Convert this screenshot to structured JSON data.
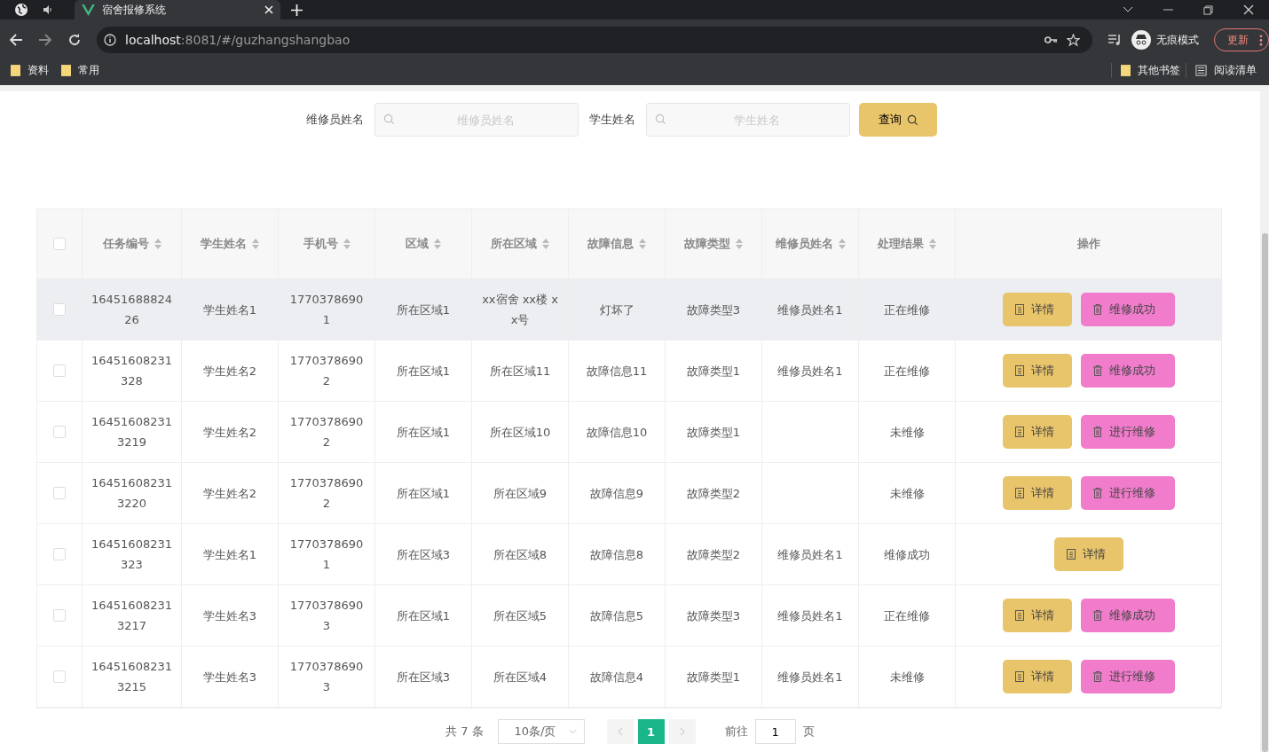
{
  "browser": {
    "tab_title": "宿舍报修系统",
    "url_host": "localhost",
    "url_rest": ":8081/#/guzhangshangbao",
    "incognito_label": "无痕模式",
    "update_button": "更新",
    "bookmarks": [
      "资料",
      "常用"
    ],
    "other_bookmarks": "其他书签",
    "reading_list": "阅读清单"
  },
  "search": {
    "fields": [
      {
        "label": "维修员姓名",
        "placeholder": "维修员姓名"
      },
      {
        "label": "学生姓名",
        "placeholder": "学生姓名"
      }
    ],
    "button": "查询"
  },
  "table": {
    "select_all_checked": false,
    "columns": [
      {
        "label": "任务编号",
        "sortable": true
      },
      {
        "label": "学生姓名",
        "sortable": true
      },
      {
        "label": "手机号",
        "sortable": true
      },
      {
        "label": "区域",
        "sortable": true
      },
      {
        "label": "所在区域",
        "sortable": true
      },
      {
        "label": "故障信息",
        "sortable": true
      },
      {
        "label": "故障类型",
        "sortable": true
      },
      {
        "label": "维修员姓名",
        "sortable": true
      },
      {
        "label": "处理结果",
        "sortable": true
      },
      {
        "label": "操作",
        "sortable": false
      }
    ],
    "rows": [
      {
        "checked": false,
        "highlighted": true,
        "cells": [
          "1645168882426",
          "学生姓名1",
          "17703786901",
          "所在区域1",
          "xx宿舍 xx楼 xx号",
          "灯坏了",
          "故障类型3",
          "维修员姓名1",
          "正在维修"
        ],
        "actions": [
          {
            "kind": "detail",
            "label": "详情"
          },
          {
            "kind": "repair",
            "label": "维修成功"
          }
        ]
      },
      {
        "checked": false,
        "highlighted": false,
        "cells": [
          "16451608231328",
          "学生姓名2",
          "17703786902",
          "所在区域1",
          "所在区域11",
          "故障信息11",
          "故障类型1",
          "维修员姓名1",
          "正在维修"
        ],
        "actions": [
          {
            "kind": "detail",
            "label": "详情"
          },
          {
            "kind": "repair",
            "label": "维修成功"
          }
        ]
      },
      {
        "checked": false,
        "highlighted": false,
        "cells": [
          "164516082313219",
          "学生姓名2",
          "17703786902",
          "所在区域1",
          "所在区域10",
          "故障信息10",
          "故障类型1",
          "",
          "未维修"
        ],
        "actions": [
          {
            "kind": "detail",
            "label": "详情"
          },
          {
            "kind": "repair",
            "label": "进行维修"
          }
        ]
      },
      {
        "checked": false,
        "highlighted": false,
        "cells": [
          "164516082313220",
          "学生姓名2",
          "17703786902",
          "所在区域1",
          "所在区域9",
          "故障信息9",
          "故障类型2",
          "",
          "未维修"
        ],
        "actions": [
          {
            "kind": "detail",
            "label": "详情"
          },
          {
            "kind": "repair",
            "label": "进行维修"
          }
        ]
      },
      {
        "checked": false,
        "highlighted": false,
        "cells": [
          "16451608231323",
          "学生姓名1",
          "17703786901",
          "所在区域3",
          "所在区域8",
          "故障信息8",
          "故障类型2",
          "维修员姓名1",
          "维修成功"
        ],
        "actions": [
          {
            "kind": "detail",
            "label": "详情"
          }
        ]
      },
      {
        "checked": false,
        "highlighted": false,
        "cells": [
          "164516082313217",
          "学生姓名3",
          "17703786903",
          "所在区域1",
          "所在区域5",
          "故障信息5",
          "故障类型3",
          "维修员姓名1",
          "正在维修"
        ],
        "actions": [
          {
            "kind": "detail",
            "label": "详情"
          },
          {
            "kind": "repair",
            "label": "维修成功"
          }
        ]
      },
      {
        "checked": false,
        "highlighted": false,
        "cells": [
          "164516082313215",
          "学生姓名3",
          "17703786903",
          "所在区域3",
          "所在区域4",
          "故障信息4",
          "故障类型1",
          "维修员姓名1",
          "未维修"
        ],
        "actions": [
          {
            "kind": "detail",
            "label": "详情"
          },
          {
            "kind": "repair",
            "label": "进行维修"
          }
        ]
      }
    ]
  },
  "pagination": {
    "total": "共 7 条",
    "page_size": "10条/页",
    "pages": [
      {
        "label": "1",
        "selected": true
      }
    ],
    "goto_label": "前往",
    "goto_value": "1",
    "goto_suffix": "页"
  }
}
